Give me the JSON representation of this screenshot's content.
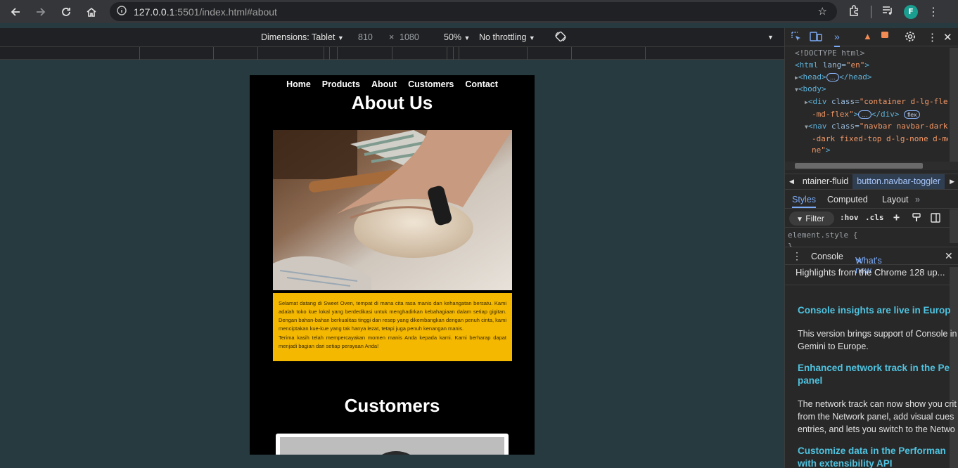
{
  "browser": {
    "url_host": "127.0.0.1",
    "url_path": ":5501/index.html#about",
    "profile_initial": "F",
    "icons": [
      "back-icon",
      "forward-icon",
      "reload-icon",
      "home-icon",
      "site-info-icon",
      "bookmark-star-icon",
      "extensions-icon",
      "media-icon",
      "profile-avatar"
    ]
  },
  "device_toolbar": {
    "dimensions_label": "Dimensions: Tablet",
    "width": "810",
    "times": "×",
    "height": "1080",
    "zoom": "50%",
    "throttling": "No throttling"
  },
  "site": {
    "nav": [
      "Home",
      "Products",
      "About",
      "Customers",
      "Contact"
    ],
    "about_title": "About Us",
    "about_p1": "Selamat datang di Sweet Oven, tempat di mana cita rasa manis dan kehangatan bersatu. Kami adalah toko kue lokal yang berdedikasi untuk menghadirkan kebahagiaan dalam setiap gigitan. Dengan bahan-bahan berkualitas tinggi dan resep yang dikembangkan dengan penuh cinta, kami menciptakan kue-kue yang tak hanya lezat, tetapi juga penuh kenangan manis.",
    "about_p2": "Terima kasih telah mempercayakan momen manis Anda kepada kami. Kami berharap dapat menjadi bagian dari setiap perayaan Anda!",
    "customers_title": "Customers",
    "accent": "#f5b800"
  },
  "devtools": {
    "elements": {
      "doctype": "<!DOCTYPE html>",
      "html_open": "<html",
      "html_attr": " lang=",
      "html_val": "\"en\"",
      "html_close": ">",
      "head": "<head>",
      "head_ellipsis": "…",
      "head_close": "</head>",
      "body": "<body>",
      "div_open": "<div",
      "div_attr": " class=",
      "div_val_1": "\"container d-lg-fle",
      "div_val_2": "-md-flex\"",
      "div_end": ">",
      "div_ellipsis": "…",
      "div_close": "</div>",
      "flex_badge": "flex",
      "nav_open": "<nav",
      "nav_attr": " class=",
      "nav_val_1": "\"navbar navbar-dark",
      "nav_val_2": "-dark fixed-top d-lg-none d-mo",
      "nav_val_3": "ne\"",
      "nav_end": ">"
    },
    "breadcrumbs": [
      "ntainer-fluid",
      "button.navbar-toggler"
    ],
    "style_tabs": [
      "Styles",
      "Computed",
      "Layout"
    ],
    "filter_label": "Filter",
    "hov": ":hov",
    "cls": ".cls",
    "element_style": "element.style {",
    "element_style_close": "}",
    "drawer_tabs": [
      "Console",
      "What's new"
    ],
    "whats_new_subtitle": "Highlights from the Chrome 128 up...",
    "h1": "Console insights are live in Europ",
    "p1a": "This version brings support of Console in",
    "p1b": "Gemini to Europe.",
    "h2a": "Enhanced network track in the Pe",
    "h2b": "panel",
    "p2a": "The network track can now show you crit",
    "p2b": "from the Network panel, add visual cues",
    "p2c": "entries, and lets you switch to the Netwo",
    "h3a": "Customize data in the Performan",
    "h3b": "with extensibility API"
  }
}
